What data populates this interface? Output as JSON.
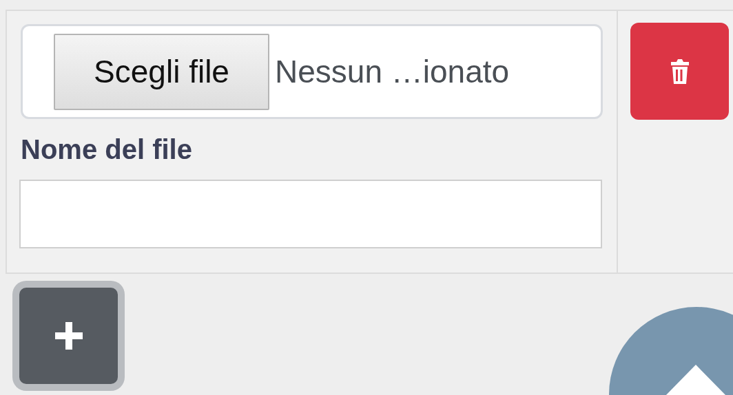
{
  "file_input": {
    "button_label": "Scegli file",
    "status_text": "Nessun …ionato"
  },
  "filename_field": {
    "label": "Nome del file"
  },
  "delete_button": {
    "kind": "icon"
  },
  "add_button": {
    "focused": true
  },
  "scroll_top_button": {
    "kind": "icon"
  }
}
